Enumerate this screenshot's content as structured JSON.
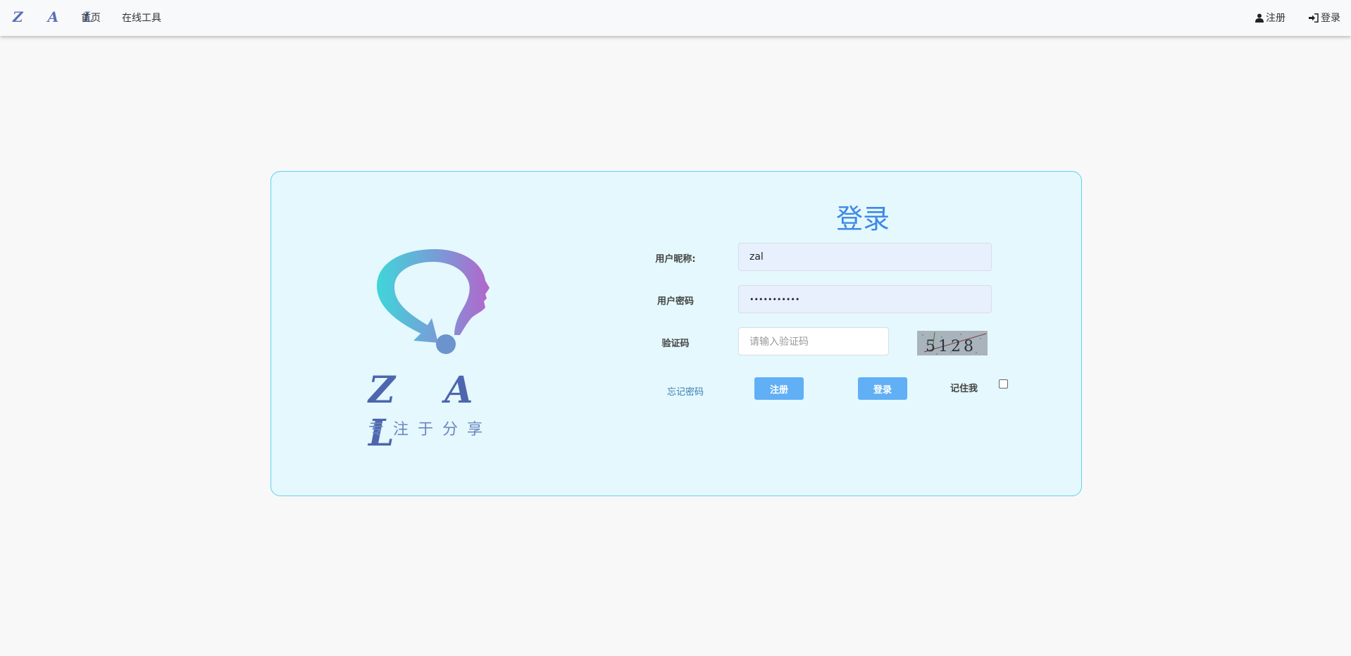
{
  "nav": {
    "brand": "Z A L",
    "links": [
      "首页",
      "在线工具"
    ],
    "register": "注册",
    "login": "登录"
  },
  "card": {
    "logo_text": "Z A L",
    "slogan": "专注于分享",
    "title": "登录",
    "fields": {
      "nickname_label": "用户昵称:",
      "nickname_value": "zal",
      "password_label": "用户密码",
      "password_value": "•••••••••••",
      "captcha_label": "验证码",
      "captcha_placeholder": "请输入验证码",
      "captcha_image_text": "5128"
    },
    "forgot": "忘记密码",
    "register_button": "注册",
    "login_button": "登录",
    "remember_me": "记住我"
  },
  "colors": {
    "accent": "#3f89e6",
    "button": "#61aff5",
    "card_bg": "#e4f8fd",
    "card_border": "#5fd3ea"
  }
}
